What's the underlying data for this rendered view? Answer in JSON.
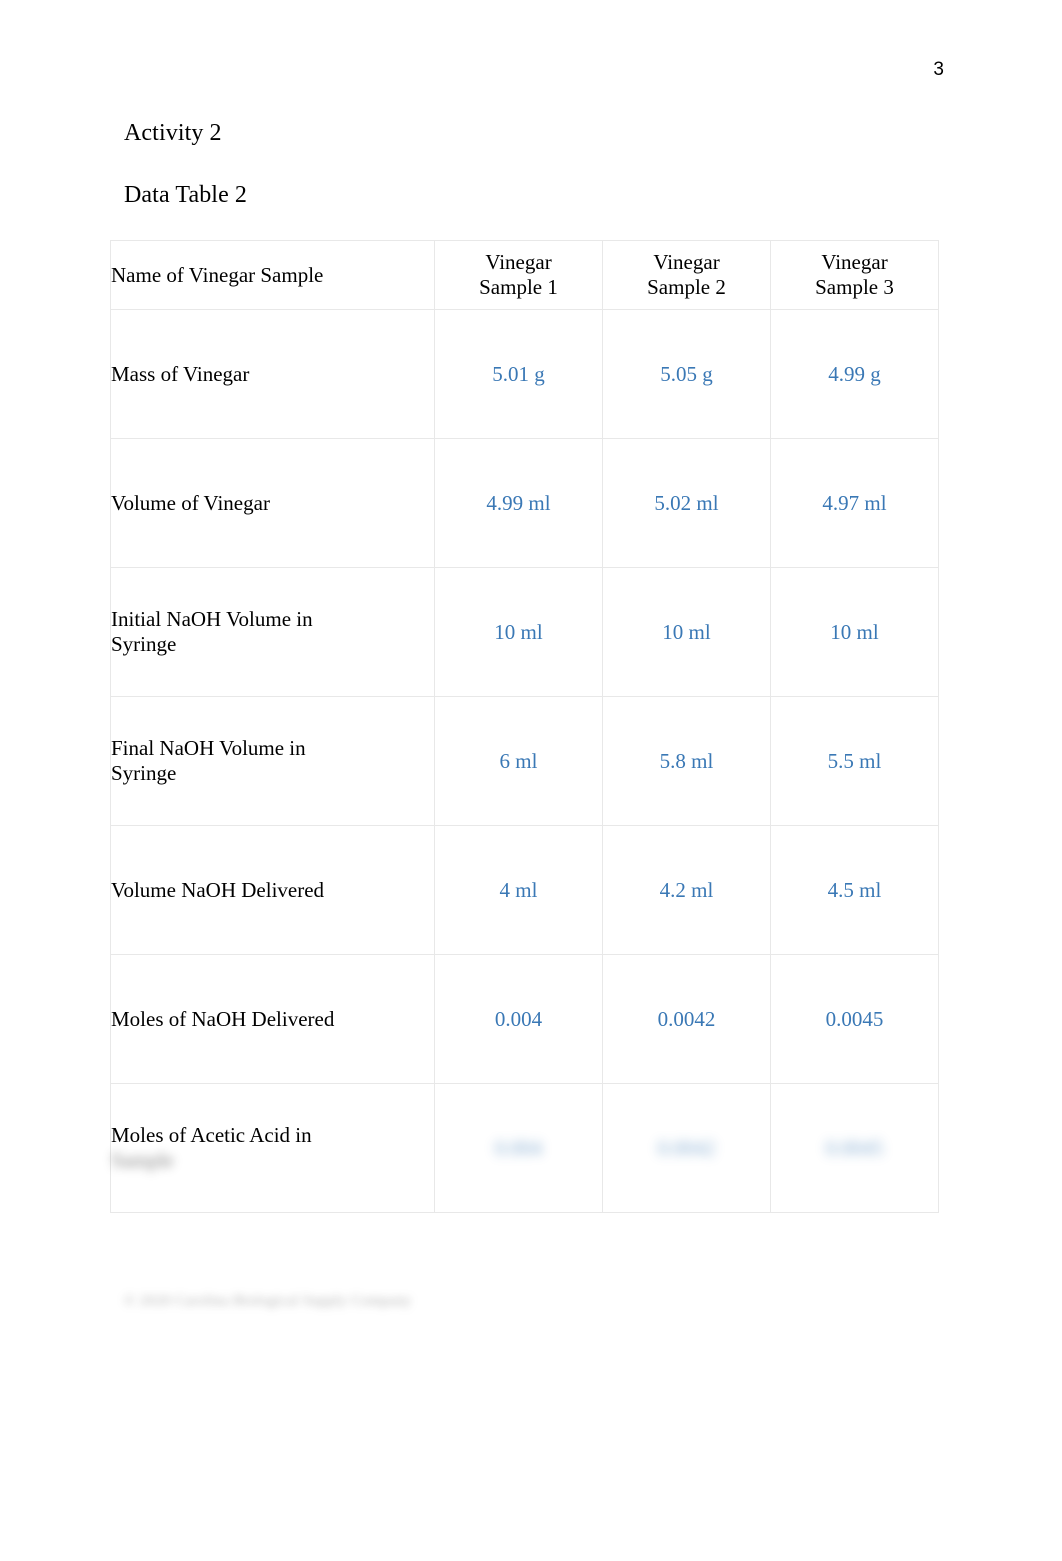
{
  "document": {
    "page_number": "3",
    "activity_heading": "Activity 2",
    "table_heading": "Data Table 2",
    "footer_text": "© 2020 Carolina Biological Supply Company",
    "footer_redacted": true,
    "value_color": "#3a78b5",
    "text_color": "#000000",
    "border_color": "#e8e8e8"
  },
  "table": {
    "columns": [
      {
        "key": "label",
        "label": "Name of Vinegar Sample",
        "lines": [
          "Name of Vinegar Sample"
        ]
      },
      {
        "key": "sample1",
        "label": "Vinegar Sample 1",
        "lines": [
          "Vinegar",
          "Sample 1"
        ]
      },
      {
        "key": "sample2",
        "label": "Vinegar Sample 2",
        "lines": [
          "Vinegar",
          "Sample 2"
        ]
      },
      {
        "key": "sample3",
        "label": "Vinegar Sample 3",
        "lines": [
          "Vinegar",
          "Sample 3"
        ]
      }
    ],
    "rows": [
      {
        "label": "Mass of Vinegar",
        "label_lines": [
          "Mass of Vinegar"
        ],
        "redacted": false,
        "values": [
          "5.01 g",
          "5.05 g",
          "4.99 g"
        ]
      },
      {
        "label": "Volume of Vinegar",
        "label_lines": [
          "Volume of Vinegar"
        ],
        "redacted": false,
        "values": [
          "4.99 ml",
          "5.02 ml",
          "4.97 ml"
        ]
      },
      {
        "label": "Initial NaOH Volume in Syringe",
        "label_lines": [
          "Initial NaOH Volume in",
          "Syringe"
        ],
        "redacted": false,
        "values": [
          "10 ml",
          "10 ml",
          "10 ml"
        ]
      },
      {
        "label": "Final NaOH Volume in Syringe",
        "label_lines": [
          "Final NaOH Volume in",
          "Syringe"
        ],
        "redacted": false,
        "values": [
          "6 ml",
          "5.8 ml",
          "5.5 ml"
        ]
      },
      {
        "label": "Volume NaOH Delivered",
        "label_lines": [
          "Volume NaOH Delivered"
        ],
        "redacted": false,
        "values": [
          "4 ml",
          "4.2 ml",
          "4.5 ml"
        ]
      },
      {
        "label": "Moles of NaOH Delivered",
        "label_lines": [
          "Moles of NaOH Delivered"
        ],
        "redacted": false,
        "values": [
          "0.004",
          "0.0042",
          "0.0045"
        ]
      },
      {
        "label": "Moles of Acetic Acid in Sample",
        "label_lines": [
          "Moles of Acetic Acid in",
          "Sample"
        ],
        "redacted": true,
        "values": [
          "0.004",
          "0.0042",
          "0.0045"
        ]
      }
    ]
  }
}
